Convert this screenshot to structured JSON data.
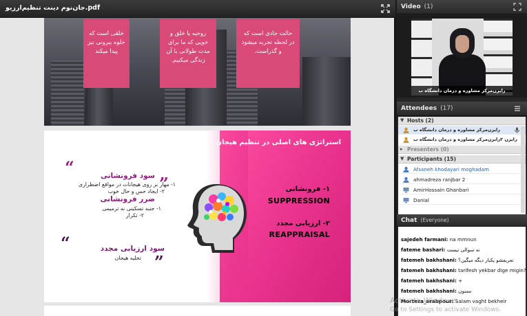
{
  "share_pod": {
    "title": "جان‌نوم دینت تنظیم‌ارزیو.pdf"
  },
  "slide1": {
    "boxes": [
      "خلقی است که حلوه بیرونی نیز پیدا میکند",
      "روحیه یا خلق و خویی که ما برای مدت طولانی با آن زندگی میکنیم.",
      "حالت جادی است که در لحظه تجربه میشود و گذراست."
    ]
  },
  "slide2": {
    "title": "استراتژی های اصلی در تنظیم هیجان",
    "item1_fa": "۱- فرونشانی",
    "item1_en": "SUPPRESSION",
    "item2_fa": "۲- ارزیابی مجدد",
    "item2_en": "REAPPRAISAL",
    "left_heading1": "سود فرونشانی",
    "left_text1a": "۱- مهار بر روی هیجانات در مواقع اضطراری",
    "left_text1b": "۲- ایجاد حس و حال خوب",
    "left_heading2": "ضرر فرونشانی",
    "left_text2a": "۱- جنبه تسکینی نه ترمیمی",
    "left_text2b": "۲- تکرار",
    "left_heading3": "سود ارزیابی مجدد",
    "left_text3": "تخلیه هیجان"
  },
  "video": {
    "title": "Video",
    "count": "(1)",
    "caption": "رایزن‌مرکز مشاوره و درمان دانشگاه ب"
  },
  "attendees": {
    "title": "Attendees",
    "count": "(17)",
    "hosts_label": "Hosts (2)",
    "hosts": [
      "رایزن‌مرکز مشاوره و درمان دانشگاه ب",
      "رایزن ۲رایزن‌مرکز مشاوره و درمان دانشگاه ب"
    ],
    "presenters_label": "Presenters (0)",
    "participants_label": "Participants (15)",
    "participants": [
      "Afsaneh khodayari moghadam",
      "ahmadreza ranjbar 2",
      "AmirHossain Ghanbari",
      "Danial"
    ]
  },
  "chat": {
    "title": "Chat",
    "scope": "(Everyone)",
    "messages": [
      {
        "who": "sajedeh farmani:",
        "msg": "na mmnun"
      },
      {
        "who": "fateme bashari:",
        "msg": "نه سوالی نیست"
      },
      {
        "who": "fatemeh bakhshani:",
        "msg": "تعریفشو یکبار دیگه میگین؟"
      },
      {
        "who": "fatemeh bakhshani:",
        "msg": "tarifesh yekbar dige migin?"
      },
      {
        "who": "fatemeh bakhshani:",
        "msg": "+"
      },
      {
        "who": "fatemeh bakhshani:",
        "msg": "ممنون"
      },
      {
        "who": "Morteza_arabpour:",
        "msg": "Salam vaght bekheir"
      }
    ]
  },
  "windows_watermark": {
    "line1": "Activate Windows",
    "line2": "Go to Settings to activate Windows."
  }
}
